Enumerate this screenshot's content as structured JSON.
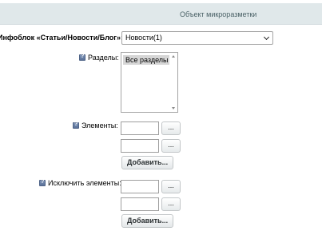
{
  "header": {
    "title": "Объект микроразметки"
  },
  "iblock": {
    "label": "Инфоблок «Статьи/Новости/Блог»:",
    "selected": "Новости(1)"
  },
  "sections": {
    "label": "Разделы:",
    "options": [
      "Все разделы"
    ]
  },
  "elements": {
    "label": "Элементы:",
    "values": [
      "",
      ""
    ],
    "browse_label": "...",
    "add_label": "Добавить..."
  },
  "exclude": {
    "label": "Исключить элементы:",
    "values": [
      "",
      ""
    ],
    "browse_label": "...",
    "add_label": "Добавить..."
  }
}
